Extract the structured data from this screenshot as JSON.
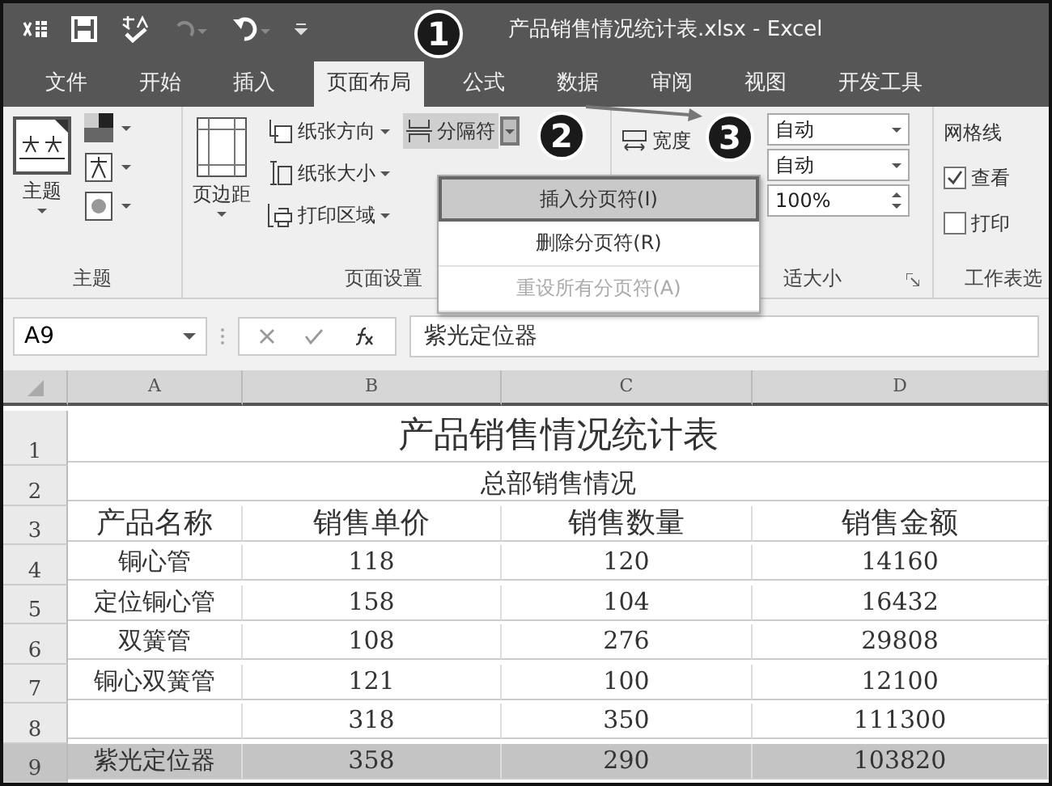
{
  "window": {
    "title": "产品销售情况统计表.xlsx - Excel"
  },
  "tabs": [
    {
      "label": "文件",
      "selected": false
    },
    {
      "label": "开始",
      "selected": false
    },
    {
      "label": "插入",
      "selected": false
    },
    {
      "label": "页面布局",
      "selected": true
    },
    {
      "label": "公式",
      "selected": false
    },
    {
      "label": "数据",
      "selected": false
    },
    {
      "label": "审阅",
      "selected": false
    },
    {
      "label": "视图",
      "selected": false
    },
    {
      "label": "开发工具",
      "selected": false
    }
  ],
  "ribbon": {
    "theme_group": {
      "button": "主题",
      "label": "主题"
    },
    "page_setup_group": {
      "margins": "页边距",
      "items": [
        "纸张方向",
        "纸张大小",
        "打印区域"
      ],
      "breaks": "分隔符",
      "label": "页面设置"
    },
    "scale_group": {
      "width": "宽度",
      "width_value": "自动",
      "height_value": "自动",
      "scale": "100%",
      "label": "适大小"
    },
    "sheet_options_group": {
      "title": "网格线",
      "options": [
        {
          "label": "查看",
          "checked": true
        },
        {
          "label": "打印",
          "checked": false
        }
      ],
      "label": "工作表选"
    }
  },
  "breaks_menu": [
    {
      "label": "插入分页符(I)",
      "selected": true,
      "disabled": false
    },
    {
      "label": "删除分页符(R)",
      "selected": false,
      "disabled": false
    },
    {
      "label": "重设所有分页符(A)",
      "selected": false,
      "disabled": true
    }
  ],
  "callouts": [
    "1",
    "2",
    "3"
  ],
  "formula_bar": {
    "name_box": "A9",
    "formula": "紫光定位器"
  },
  "sheet": {
    "columns": [
      "A",
      "B",
      "C",
      "D"
    ],
    "rows": [
      {
        "number": "1",
        "kind": "title",
        "selected": false,
        "cells": [
          "产品销售情况统计表"
        ]
      },
      {
        "number": "2",
        "kind": "subtitle",
        "selected": false,
        "cells": [
          "总部销售情况"
        ]
      },
      {
        "number": "3",
        "kind": "header",
        "selected": false,
        "cells": [
          "产品名称",
          "销售单价",
          "销售数量",
          "销售金额"
        ]
      },
      {
        "number": "4",
        "kind": "data",
        "selected": false,
        "cells": [
          "铜心管",
          "118",
          "120",
          "14160"
        ]
      },
      {
        "number": "5",
        "kind": "data",
        "selected": false,
        "cells": [
          "定位铜心管",
          "158",
          "104",
          "16432"
        ]
      },
      {
        "number": "6",
        "kind": "data",
        "selected": false,
        "cells": [
          "双簧管",
          "108",
          "276",
          "29808"
        ]
      },
      {
        "number": "7",
        "kind": "data",
        "selected": false,
        "cells": [
          "铜心双簧管",
          "121",
          "100",
          "12100"
        ]
      },
      {
        "number": "8",
        "kind": "data",
        "selected": false,
        "cells": [
          null,
          "318",
          "350",
          "111300"
        ]
      },
      {
        "number": "9",
        "kind": "data",
        "selected": true,
        "cells": [
          "紫光定位器",
          "358",
          "290",
          "103820"
        ]
      }
    ]
  }
}
